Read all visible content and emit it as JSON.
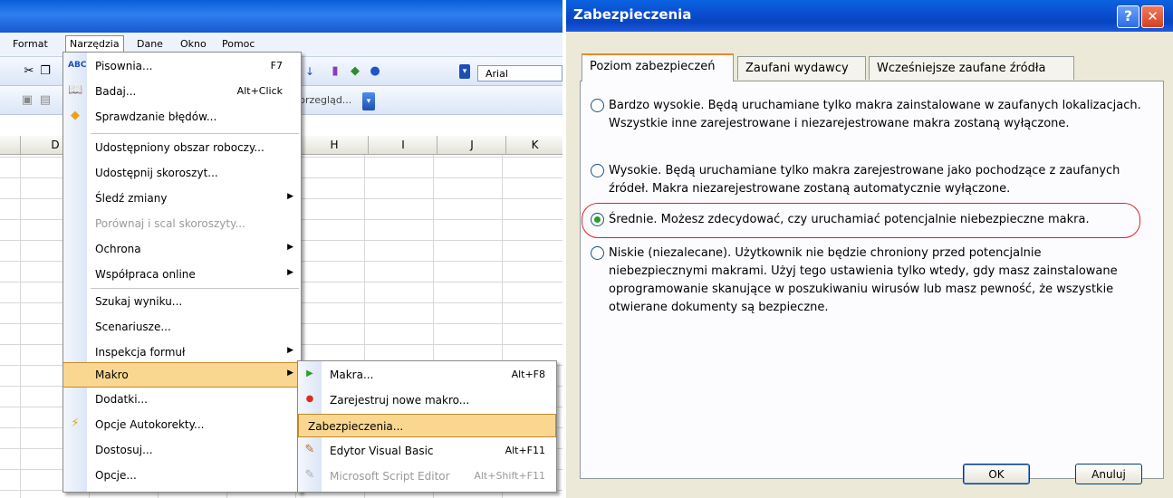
{
  "excel": {
    "menubar": [
      "Format",
      "Narzędzia",
      "Dane",
      "Okno",
      "Pomoc"
    ],
    "font_name": "Arial",
    "preview_text": "przegląd...",
    "columns": [
      "D",
      "H",
      "I",
      "J",
      "K"
    ],
    "tools_menu": [
      {
        "label": "Pisownia...",
        "shortcut": "F7",
        "icon": "spelling-icon"
      },
      {
        "label": "Badaj...",
        "shortcut": "Alt+Click",
        "icon": "research-icon"
      },
      {
        "label": "Sprawdzanie błędów...",
        "icon": "error-check-icon"
      },
      {
        "label": "Udostępniony obszar roboczy..."
      },
      {
        "label": "Udostępnij skoroszyt..."
      },
      {
        "label": "Śledź zmiany",
        "submenu": true
      },
      {
        "label": "Porównaj i scal skoroszyty...",
        "disabled": true
      },
      {
        "label": "Ochrona",
        "submenu": true
      },
      {
        "label": "Współpraca online",
        "submenu": true
      },
      {
        "label": "Szukaj wyniku..."
      },
      {
        "label": "Scenariusze..."
      },
      {
        "label": "Inspekcja formuł",
        "submenu": true
      },
      {
        "label": "Makro",
        "submenu": true,
        "highlighted": true
      },
      {
        "label": "Dodatki..."
      },
      {
        "label": "Opcje Autokorekty...",
        "icon": "autocorrect-icon"
      },
      {
        "label": "Dostosuj..."
      },
      {
        "label": "Opcje..."
      }
    ],
    "macro_menu": [
      {
        "label": "Makra...",
        "shortcut": "Alt+F8",
        "icon": "play-icon"
      },
      {
        "label": "Zarejestruj nowe makro...",
        "icon": "record-icon"
      },
      {
        "label": "Zabezpieczenia...",
        "highlighted": true
      },
      {
        "label": "Edytor Visual Basic",
        "shortcut": "Alt+F11",
        "icon": "vb-editor-icon"
      },
      {
        "label": "Microsoft Script Editor",
        "shortcut": "Alt+Shift+F11",
        "disabled": true,
        "icon": "script-editor-icon"
      }
    ]
  },
  "dialog": {
    "title": "Zabezpieczenia",
    "help_label": "?",
    "close_label": "✕",
    "tabs": [
      "Poziom zabezpieczeń",
      "Zaufani wydawcy",
      "Wcześniejsze zaufane źródła"
    ],
    "options": [
      {
        "text": "Bardzo wysokie. Będą uruchamiane tylko makra zainstalowane w zaufanych lokalizacjach. Wszystkie inne zarejestrowane i niezarejestrowane makra zostaną wyłączone.",
        "checked": false
      },
      {
        "text": "Wysokie. Będą uruchamiane tylko makra zarejestrowane jako pochodzące z zaufanych źródeł. Makra niezarejestrowane zostaną automatycznie wyłączone.",
        "checked": false
      },
      {
        "text": "Średnie. Możesz zdecydować, czy uruchamiać potencjalnie niebezpieczne makra.",
        "checked": true
      },
      {
        "text": "Niskie (niezalecane). Użytkownik nie będzie chroniony przed potencjalnie niebezpiecznymi makrami. Użyj tego ustawienia tylko wtedy, gdy masz zainstalowane oprogramowanie skanujące w poszukiwaniu wirusów lub masz pewność, że wszystkie otwierane dokumenty są bezpieczne.",
        "checked": false
      }
    ],
    "ok_label": "OK",
    "cancel_label": "Anuluj",
    "highlight_color": "#e0242a"
  }
}
